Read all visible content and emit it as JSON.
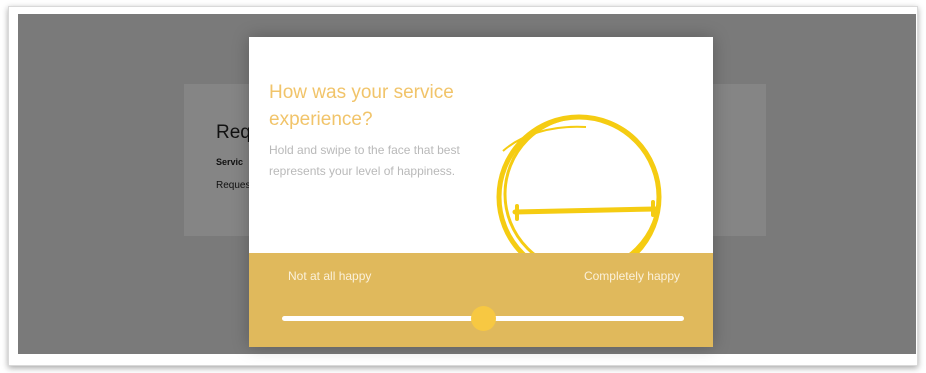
{
  "background_page": {
    "title": "Req",
    "line1": "Servic",
    "line2": "Reques"
  },
  "modal": {
    "title": "How was your service experience?",
    "subtitle": "Hold and swipe to the face that best represents your level of happiness.",
    "face_icon": "neutral-face-icon",
    "slider": {
      "left_label": "Not at all happy",
      "right_label": "Completely happy",
      "value_fraction": 0.5
    }
  },
  "colors": {
    "accent": "#f1c46a",
    "footer": "#e0b95c",
    "face_stroke": "#f5cc12",
    "thumb": "#f7c842",
    "overlay": "#7a7a7a"
  }
}
